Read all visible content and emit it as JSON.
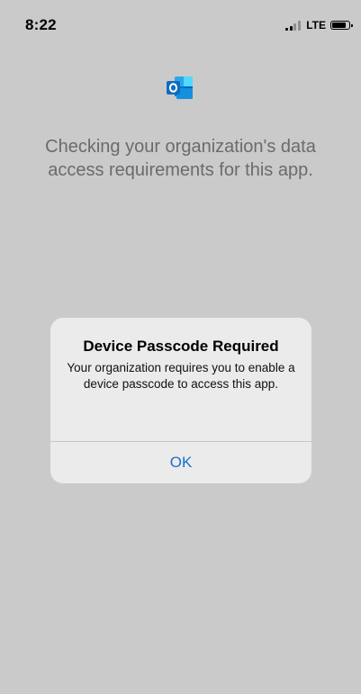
{
  "status_bar": {
    "time": "8:22",
    "network": "LTE",
    "battery_level": 0.85
  },
  "app": {
    "icon": "outlook-icon",
    "brand_color": "#0f6cbd",
    "checking_message": "Checking your organization's data access requirements for this app."
  },
  "alert": {
    "title": "Device Passcode Required",
    "message": "Your organization requires you to enable a device passcode to access this app.",
    "ok_label": "OK",
    "button_color": "#1a70c9"
  }
}
